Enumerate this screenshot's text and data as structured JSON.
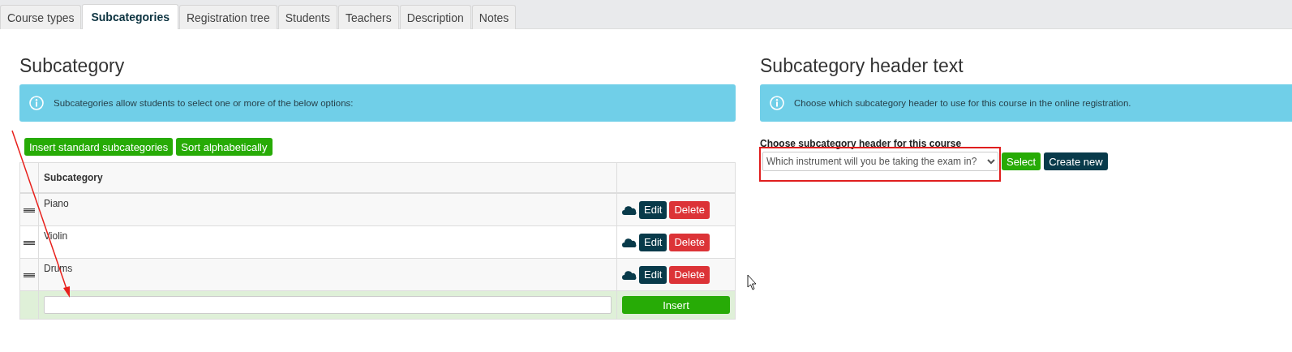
{
  "tabs": [
    {
      "label": "Course types",
      "selected": false
    },
    {
      "label": "Subcategories",
      "selected": true
    },
    {
      "label": "Registration tree",
      "selected": false
    },
    {
      "label": "Students",
      "selected": false
    },
    {
      "label": "Teachers",
      "selected": false
    },
    {
      "label": "Description",
      "selected": false
    },
    {
      "label": "Notes",
      "selected": false
    }
  ],
  "subcategory": {
    "title": "Subcategory",
    "info": "Subcategories allow students to select one or more of the below options:",
    "buttons": [
      "Insert standard subcategories",
      "Sort alphabetically"
    ],
    "table": {
      "columns": [
        "Subcategory"
      ],
      "rows": [
        {
          "name": "Piano",
          "edit": "Edit",
          "delete": "Delete"
        },
        {
          "name": "Violin",
          "edit": "Edit",
          "delete": "Delete"
        },
        {
          "name": "Drums",
          "edit": "Edit",
          "delete": "Delete"
        }
      ],
      "insert_button": "Insert"
    }
  },
  "header_text": {
    "title": "Subcategory header text",
    "info": "Choose which subcategory header to use for this course in the online registration.",
    "label": "Choose subcategory header for this course",
    "select_value": "Which instrument will you be taking the exam in?",
    "buttons": [
      {
        "label": "Select",
        "kind": "primary"
      },
      {
        "label": "Create new",
        "kind": "dark"
      }
    ]
  }
}
